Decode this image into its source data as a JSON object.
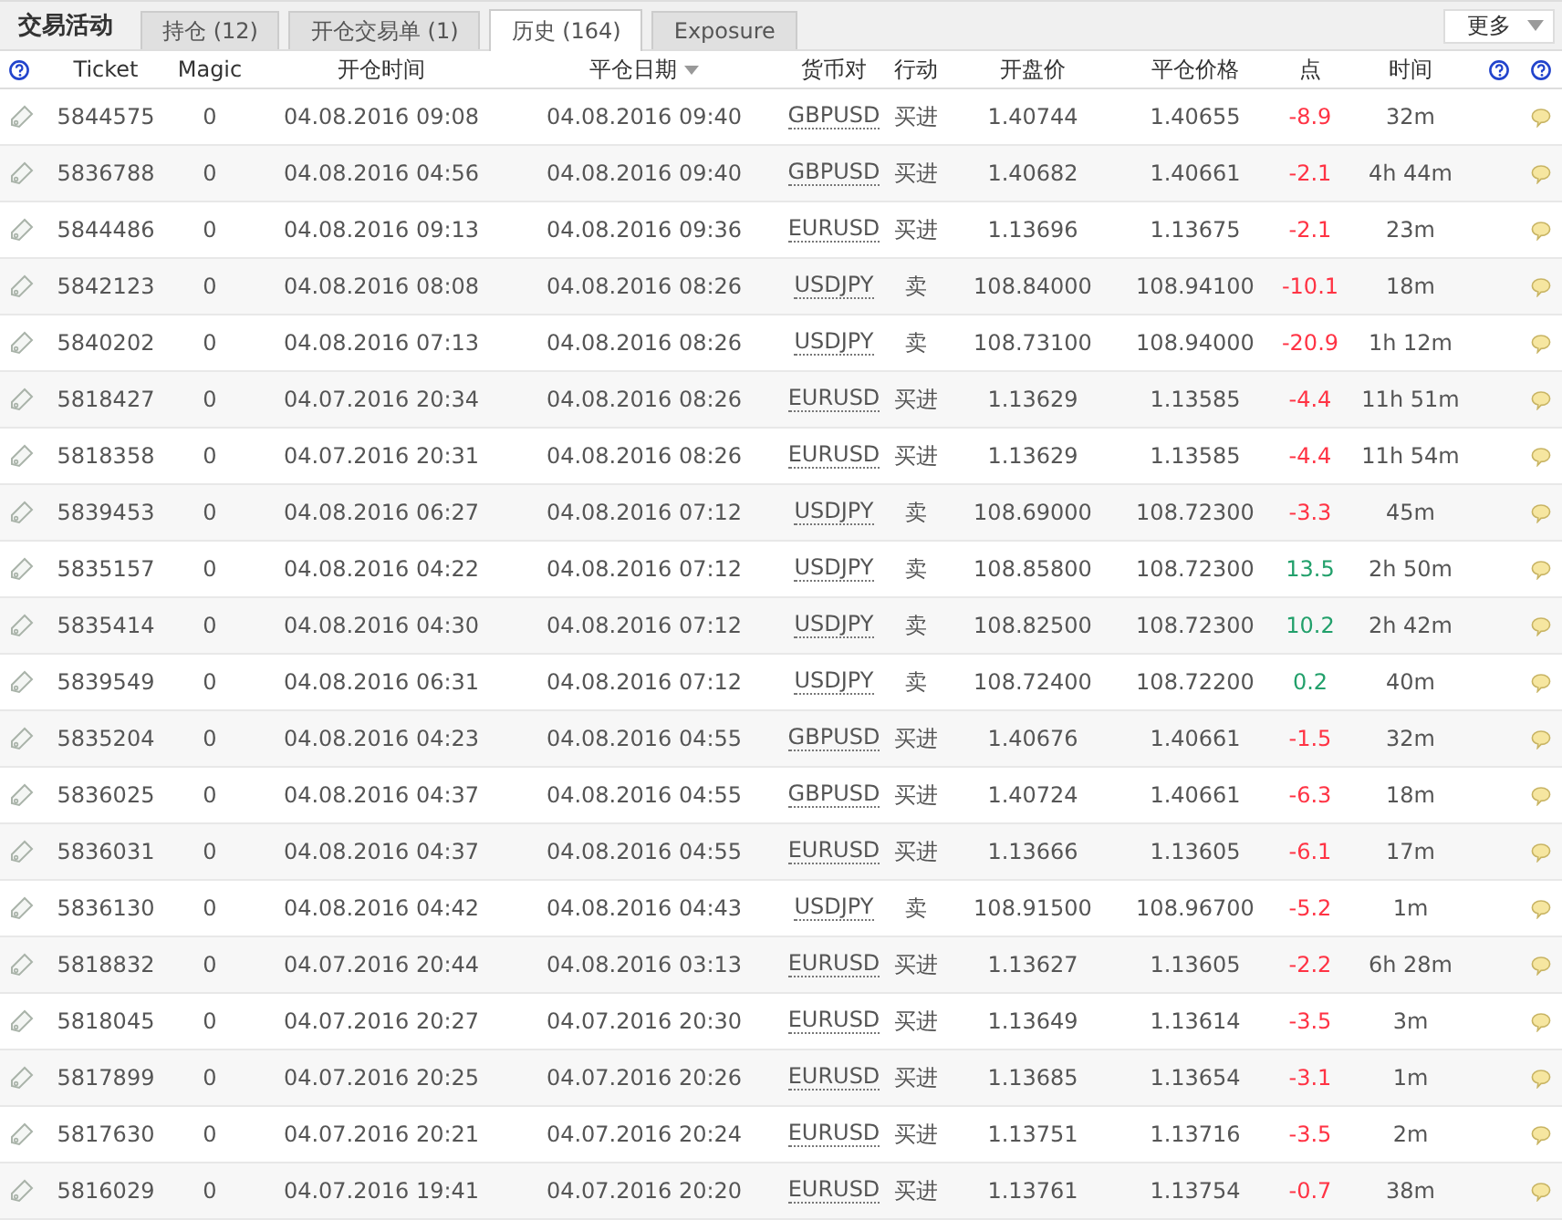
{
  "panel": {
    "title": "交易活动",
    "more_button": "更多"
  },
  "tabs": [
    {
      "label": "持仓 (12)",
      "selected": false
    },
    {
      "label": "开仓交易单 (1)",
      "selected": false
    },
    {
      "label": "历史 (164)",
      "selected": true
    },
    {
      "label": "Exposure",
      "selected": false
    }
  ],
  "table": {
    "columns": [
      {
        "label": "Ticket",
        "sorted": false
      },
      {
        "label": "Magic",
        "sorted": false
      },
      {
        "label": "开仓时间",
        "sorted": false
      },
      {
        "label": "平仓日期",
        "sorted": true
      },
      {
        "label": "货币对",
        "sorted": false
      },
      {
        "label": "行动",
        "sorted": false
      },
      {
        "label": "开盘价",
        "sorted": false
      },
      {
        "label": "平仓价格",
        "sorted": false
      },
      {
        "label": "点",
        "sorted": false
      },
      {
        "label": "时间",
        "sorted": false
      }
    ],
    "rows": [
      {
        "ticket": "5844575",
        "magic": "0",
        "open_time": "04.08.2016 09:08",
        "close_time": "04.08.2016 09:40",
        "pair": "GBPUSD",
        "action": "买进",
        "open_price": "1.40744",
        "close_price": "1.40655",
        "points": "-8.9",
        "color": "#ff3344",
        "duration": "32m"
      },
      {
        "ticket": "5836788",
        "magic": "0",
        "open_time": "04.08.2016 04:56",
        "close_time": "04.08.2016 09:40",
        "pair": "GBPUSD",
        "action": "买进",
        "open_price": "1.40682",
        "close_price": "1.40661",
        "points": "-2.1",
        "color": "#ff3344",
        "duration": "4h 44m"
      },
      {
        "ticket": "5844486",
        "magic": "0",
        "open_time": "04.08.2016 09:13",
        "close_time": "04.08.2016 09:36",
        "pair": "EURUSD",
        "action": "买进",
        "open_price": "1.13696",
        "close_price": "1.13675",
        "points": "-2.1",
        "color": "#ff3344",
        "duration": "23m"
      },
      {
        "ticket": "5842123",
        "magic": "0",
        "open_time": "04.08.2016 08:08",
        "close_time": "04.08.2016 08:26",
        "pair": "USDJPY",
        "action": "卖",
        "open_price": "108.84000",
        "close_price": "108.94100",
        "points": "-10.1",
        "color": "#ff3344",
        "duration": "18m"
      },
      {
        "ticket": "5840202",
        "magic": "0",
        "open_time": "04.08.2016 07:13",
        "close_time": "04.08.2016 08:26",
        "pair": "USDJPY",
        "action": "卖",
        "open_price": "108.73100",
        "close_price": "108.94000",
        "points": "-20.9",
        "color": "#ff3344",
        "duration": "1h 12m"
      },
      {
        "ticket": "5818427",
        "magic": "0",
        "open_time": "04.07.2016 20:34",
        "close_time": "04.08.2016 08:26",
        "pair": "EURUSD",
        "action": "买进",
        "open_price": "1.13629",
        "close_price": "1.13585",
        "points": "-4.4",
        "color": "#ff3344",
        "duration": "11h 51m"
      },
      {
        "ticket": "5818358",
        "magic": "0",
        "open_time": "04.07.2016 20:31",
        "close_time": "04.08.2016 08:26",
        "pair": "EURUSD",
        "action": "买进",
        "open_price": "1.13629",
        "close_price": "1.13585",
        "points": "-4.4",
        "color": "#ff3344",
        "duration": "11h 54m"
      },
      {
        "ticket": "5839453",
        "magic": "0",
        "open_time": "04.08.2016 06:27",
        "close_time": "04.08.2016 07:12",
        "pair": "USDJPY",
        "action": "卖",
        "open_price": "108.69000",
        "close_price": "108.72300",
        "points": "-3.3",
        "color": "#ff3344",
        "duration": "45m"
      },
      {
        "ticket": "5835157",
        "magic": "0",
        "open_time": "04.08.2016 04:22",
        "close_time": "04.08.2016 07:12",
        "pair": "USDJPY",
        "action": "卖",
        "open_price": "108.85800",
        "close_price": "108.72300",
        "points": "13.5",
        "color": "#22a06b",
        "duration": "2h 50m"
      },
      {
        "ticket": "5835414",
        "magic": "0",
        "open_time": "04.08.2016 04:30",
        "close_time": "04.08.2016 07:12",
        "pair": "USDJPY",
        "action": "卖",
        "open_price": "108.82500",
        "close_price": "108.72300",
        "points": "10.2",
        "color": "#22a06b",
        "duration": "2h 42m"
      },
      {
        "ticket": "5839549",
        "magic": "0",
        "open_time": "04.08.2016 06:31",
        "close_time": "04.08.2016 07:12",
        "pair": "USDJPY",
        "action": "卖",
        "open_price": "108.72400",
        "close_price": "108.72200",
        "points": "0.2",
        "color": "#22a06b",
        "duration": "40m"
      },
      {
        "ticket": "5835204",
        "magic": "0",
        "open_time": "04.08.2016 04:23",
        "close_time": "04.08.2016 04:55",
        "pair": "GBPUSD",
        "action": "买进",
        "open_price": "1.40676",
        "close_price": "1.40661",
        "points": "-1.5",
        "color": "#ff3344",
        "duration": "32m"
      },
      {
        "ticket": "5836025",
        "magic": "0",
        "open_time": "04.08.2016 04:37",
        "close_time": "04.08.2016 04:55",
        "pair": "GBPUSD",
        "action": "买进",
        "open_price": "1.40724",
        "close_price": "1.40661",
        "points": "-6.3",
        "color": "#ff3344",
        "duration": "18m"
      },
      {
        "ticket": "5836031",
        "magic": "0",
        "open_time": "04.08.2016 04:37",
        "close_time": "04.08.2016 04:55",
        "pair": "EURUSD",
        "action": "买进",
        "open_price": "1.13666",
        "close_price": "1.13605",
        "points": "-6.1",
        "color": "#ff3344",
        "duration": "17m"
      },
      {
        "ticket": "5836130",
        "magic": "0",
        "open_time": "04.08.2016 04:42",
        "close_time": "04.08.2016 04:43",
        "pair": "USDJPY",
        "action": "卖",
        "open_price": "108.91500",
        "close_price": "108.96700",
        "points": "-5.2",
        "color": "#ff3344",
        "duration": "1m"
      },
      {
        "ticket": "5818832",
        "magic": "0",
        "open_time": "04.07.2016 20:44",
        "close_time": "04.08.2016 03:13",
        "pair": "EURUSD",
        "action": "买进",
        "open_price": "1.13627",
        "close_price": "1.13605",
        "points": "-2.2",
        "color": "#ff3344",
        "duration": "6h 28m"
      },
      {
        "ticket": "5818045",
        "magic": "0",
        "open_time": "04.07.2016 20:27",
        "close_time": "04.07.2016 20:30",
        "pair": "EURUSD",
        "action": "买进",
        "open_price": "1.13649",
        "close_price": "1.13614",
        "points": "-3.5",
        "color": "#ff3344",
        "duration": "3m"
      },
      {
        "ticket": "5817899",
        "magic": "0",
        "open_time": "04.07.2016 20:25",
        "close_time": "04.07.2016 20:26",
        "pair": "EURUSD",
        "action": "买进",
        "open_price": "1.13685",
        "close_price": "1.13654",
        "points": "-3.1",
        "color": "#ff3344",
        "duration": "1m"
      },
      {
        "ticket": "5817630",
        "magic": "0",
        "open_time": "04.07.2016 20:21",
        "close_time": "04.07.2016 20:24",
        "pair": "EURUSD",
        "action": "买进",
        "open_price": "1.13751",
        "close_price": "1.13716",
        "points": "-3.5",
        "color": "#ff3344",
        "duration": "2m"
      },
      {
        "ticket": "5816029",
        "magic": "0",
        "open_time": "04.07.2016 19:41",
        "close_time": "04.07.2016 20:20",
        "pair": "EURUSD",
        "action": "买进",
        "open_price": "1.13761",
        "close_price": "1.13754",
        "points": "-0.7",
        "color": "#ff3344",
        "duration": "38m"
      }
    ]
  }
}
